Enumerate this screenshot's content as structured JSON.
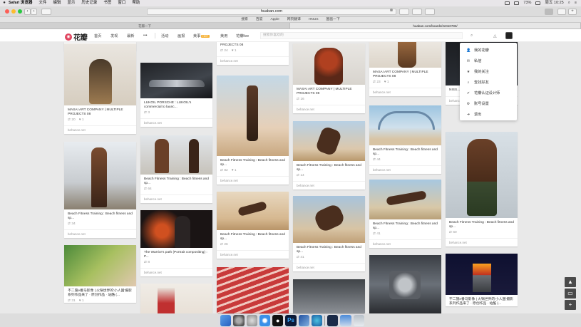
{
  "menubar": {
    "app": "Safari 浏览器",
    "items": [
      "文件",
      "编辑",
      "显示",
      "历史记录",
      "书签",
      "窗口",
      "帮助"
    ],
    "battery": "73%",
    "clock": "周五 10:25"
  },
  "toolbar": {
    "url": "huaban.com"
  },
  "bookmarks": [
    "搜索",
    "百度",
    "Apple",
    "网页翻译",
    "HNUS",
    "国画一下"
  ],
  "tabs": [
    {
      "label": "花瓣一下"
    },
    {
      "label": "huaban.com/boards/22410783/"
    }
  ],
  "nav": {
    "logo": "花瓣",
    "logo_glyph": "◉",
    "items": [
      "首页",
      "发现",
      "最新",
      "•••",
      "活动",
      "画报",
      "美事",
      "美用",
      "花瓣live"
    ],
    "hot_badge": "HOT",
    "search_placeholder": "搜索你喜欢的"
  },
  "dropdown": {
    "items": [
      {
        "label": "我的花瓣",
        "icon": "person-icon",
        "glyph": "👤"
      },
      {
        "label": "私信",
        "icon": "message-icon",
        "glyph": "✉"
      },
      {
        "label": "我的关注",
        "icon": "follow-icon",
        "glyph": "★"
      },
      {
        "label": "查找好友",
        "icon": "search-friend-icon",
        "glyph": "⌕"
      },
      {
        "label": "花瓣认证设计师",
        "icon": "verified-icon",
        "glyph": "✔"
      },
      {
        "label": "账号设置",
        "icon": "settings-icon",
        "glyph": "⚙"
      },
      {
        "label": "退出",
        "icon": "logout-icon",
        "glyph": "➜"
      }
    ]
  },
  "float_buttons": [
    "▲",
    "▭",
    "+"
  ],
  "cards": [
    {
      "title": "",
      "repins": "3",
      "likes": "",
      "source": "behance.net"
    },
    {
      "title": "MASAI ART COMPANY | MULTIPLE PROJECTS 08",
      "repins": "20",
      "likes": "1",
      "source": "behance.net"
    },
    {
      "title": "Beach Fitness Training : Beach fitness and sp...",
      "repins": "34",
      "likes": "",
      "source": "behance.net"
    },
    {
      "title": "不二施e番马影像 | 火锅世界的'小人国'摄影系列作品来了 · 原创作品 · 站酷 (...",
      "repins": "31",
      "likes": "1",
      "source": ""
    },
    {
      "title": "LUKOIL PORSCHE : LUKOIL's commercial to launc...",
      "repins": "3",
      "likes": "",
      "source": "behance.net"
    },
    {
      "title": "Beach Fitness Training : Beach fitness and sp...",
      "repins": "64",
      "likes": "",
      "source": "behance.net"
    },
    {
      "title": "The Warrior's path (Portrait compositing) : P...",
      "repins": "8",
      "likes": "",
      "source": "behance.net"
    },
    {
      "title": "MASAI ART COMPANY | MULTIPLE PROJECTS 08",
      "repins": "24",
      "likes": "1",
      "source": "behance.net"
    },
    {
      "title": "Beach Fitness Training : Beach fitness and sp...",
      "repins": "82",
      "likes": "1",
      "source": "behance.net"
    },
    {
      "title": "Beach Fitness Training : Beach fitness and sp...",
      "repins": "26",
      "likes": "",
      "source": "behance.net"
    },
    {
      "title": "MASAI ART COMPANY | MULTIPLE PROJECTS 08",
      "repins": "16",
      "likes": "",
      "source": "behance.net"
    },
    {
      "title": "Beach Fitness Training : Beach fitness and sp...",
      "repins": "14",
      "likes": "",
      "source": "behance.net"
    },
    {
      "title": "Beach Fitness Training : Beach fitness and sp...",
      "repins": "41",
      "likes": "",
      "source": "behance.net"
    },
    {
      "title": "MASAI ART COMPANY | MULTIPLE PROJECTS 08",
      "repins": "23",
      "likes": "1",
      "source": "behance.net"
    },
    {
      "title": "Beach Fitness Training : Beach fitness and sp...",
      "repins": "44",
      "likes": "",
      "source": "behance.net"
    },
    {
      "title": "Beach Fitness Training : Beach fitness and sp...",
      "repins": "41",
      "likes": "",
      "source": "behance.net"
    },
    {
      "title": "NISS...",
      "repins": "",
      "likes": "",
      "source": "behance.net"
    },
    {
      "title": "Beach Fitness Training : Beach fitness and sp...",
      "repins": "60",
      "likes": "",
      "source": "behance.net"
    },
    {
      "title": "不二施e番马影像 | 火锅世界的'小人国'摄影系列作品来了 · 原创作品 · 站酷 (...",
      "repins": "",
      "likes": "",
      "source": ""
    }
  ],
  "colors": {
    "brand": "#e0445e",
    "hot": "#f6b33a"
  }
}
